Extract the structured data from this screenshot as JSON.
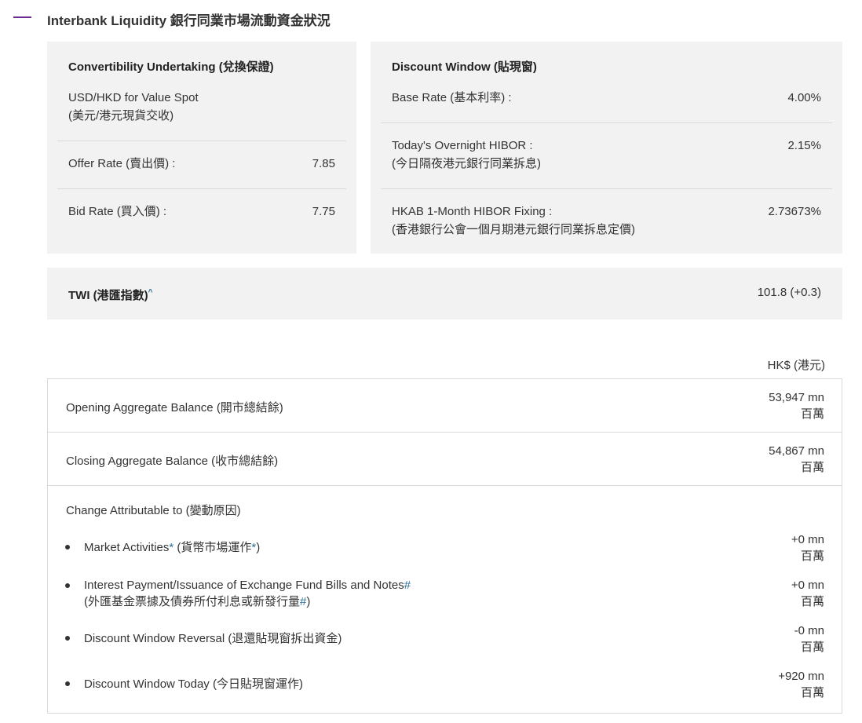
{
  "header": {
    "title": "Interbank Liquidity 銀行同業市場流動資金狀況"
  },
  "convertibility": {
    "title": "Convertibility Undertaking (兌換保證)",
    "spot_label_en": "USD/HKD for Value Spot",
    "spot_label_zh": "(美元/港元現貨交收)",
    "offer_label": "Offer Rate (賣出價) :",
    "offer_value": "7.85",
    "bid_label": "Bid Rate (買入價) :",
    "bid_value": "7.75"
  },
  "discount_window": {
    "title": "Discount Window (貼現窗)",
    "base_label": "Base Rate (基本利率) :",
    "base_value": "4.00%",
    "overnight_label_en": "Today's Overnight HIBOR :",
    "overnight_label_zh": "(今日隔夜港元銀行同業拆息)",
    "overnight_value": "2.15%",
    "fixing_label_en": "HKAB 1-Month HIBOR Fixing :",
    "fixing_label_zh": "(香港銀行公會一個月期港元銀行同業拆息定價)",
    "fixing_value": "2.73673%"
  },
  "twi": {
    "label": "TWI (港匯指數)",
    "caret": "^",
    "value": "101.8 (+0.3)"
  },
  "balance": {
    "currency": "HK$ (港元)",
    "unit_zh": "百萬",
    "opening_label": "Opening Aggregate Balance (開市總結餘)",
    "opening_value": "53,947 mn",
    "closing_label": "Closing Aggregate Balance (收市總結餘)",
    "closing_value": "54,867 mn",
    "change_title": "Change Attributable to (變動原因)",
    "items": [
      {
        "label_pre": "Market Activities",
        "mark": "*",
        "label_mid": " (貨幣市場運作",
        "label_end": ")",
        "value": "+0 mn"
      },
      {
        "label_pre": "Interest Payment/Issuance of Exchange Fund Bills and Notes",
        "mark": "#",
        "label2_pre": "(外匯基金票據及債券所付利息或新發行量",
        "label2_end": ")",
        "value": "+0 mn"
      },
      {
        "label": "Discount Window Reversal (退還貼現窗拆出資金)",
        "value": "-0 mn"
      },
      {
        "label": "Discount Window Today (今日貼現窗運作)",
        "value": "+920 mn"
      }
    ]
  }
}
